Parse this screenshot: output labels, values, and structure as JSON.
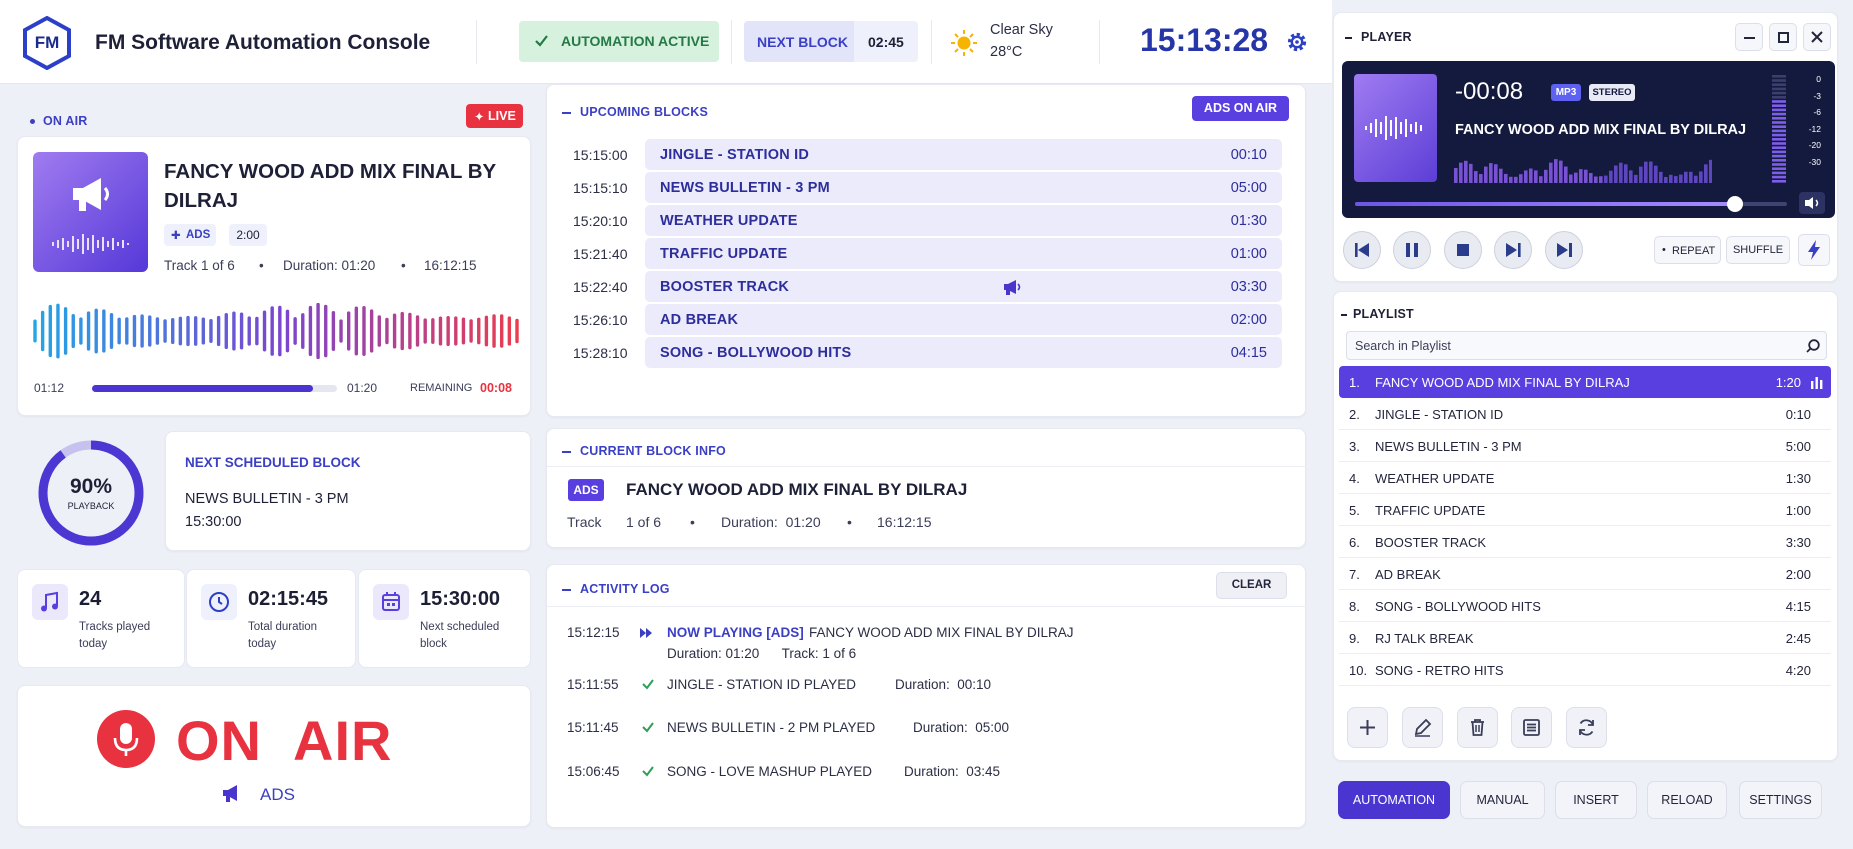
{
  "header": {
    "logo": "FM",
    "title": "FM Software Automation Console",
    "status": "AUTOMATION ACTIVE",
    "next_block_label": "NEXT BLOCK",
    "next_block_time": "02:45",
    "weather": "Clear Sky",
    "temperature": "28°C",
    "clock": "15:13:28"
  },
  "on_air": {
    "section": "ON AIR",
    "live_badge": "LIVE",
    "title_line1": "FANCY WOOD ADD MIX FINAL BY",
    "title_line2": "DILRAJ",
    "tag": "ADS",
    "tag_duration": "2:00",
    "track": "Track 1 of 6",
    "dot": "•",
    "duration": "Duration: 01:20",
    "start_time": "16:12:15",
    "elapsed": "01:12",
    "total": "01:20",
    "remaining_label": "REMAINING",
    "remaining": "00:08",
    "progress": 0.9
  },
  "next_scheduled": {
    "percent": "90%",
    "percent_value": 0.9,
    "percent_label": "PLAYBACK",
    "heading": "NEXT SCHEDULED BLOCK",
    "name": "NEWS BULLETIN - 3 PM",
    "time": "15:30:00"
  },
  "stats": [
    {
      "value": "24",
      "label1": "Tracks played",
      "label2": "today",
      "icon": "music-note-icon"
    },
    {
      "value": "02:15:45",
      "label1": "Total duration",
      "label2": "today",
      "icon": "clock-icon"
    },
    {
      "value": "15:30:00",
      "label1": "Next scheduled",
      "label2": "block",
      "icon": "calendar-icon"
    }
  ],
  "on_air_sign": {
    "text": "ON  AIR",
    "sub": "ADS"
  },
  "upcoming": {
    "section": "UPCOMING BLOCKS",
    "badge": "ADS ON AIR",
    "rows": [
      {
        "time": "15:15:00",
        "name": "JINGLE - STATION ID",
        "duration": "00:10"
      },
      {
        "time": "15:15:10",
        "name": "NEWS BULLETIN - 3 PM",
        "duration": "05:00"
      },
      {
        "time": "15:20:10",
        "name": "WEATHER UPDATE",
        "duration": "01:30"
      },
      {
        "time": "15:21:40",
        "name": "TRAFFIC UPDATE",
        "duration": "01:00"
      },
      {
        "time": "15:22:40",
        "name": "BOOSTER TRACK",
        "duration": "03:30"
      },
      {
        "time": "15:26:10",
        "name": "AD BREAK",
        "duration": "02:00"
      },
      {
        "time": "15:28:10",
        "name": "SONG - BOLLYWOOD HITS",
        "duration": "04:15"
      }
    ]
  },
  "current_block": {
    "section": "CURRENT BLOCK INFO",
    "tag": "ADS",
    "title": "FANCY WOOD ADD MIX FINAL BY DILRAJ",
    "track_label": "Track",
    "track": "1 of 6",
    "duration": "Duration:  01:20",
    "start": "16:12:15"
  },
  "activity": {
    "section": "ACTIVITY LOG",
    "clear": "CLEAR",
    "rows": [
      {
        "time": "15:12:15",
        "highlight": "NOW PLAYING [ADS]",
        "text": "FANCY WOOD ADD MIX FINAL BY DILRAJ",
        "sub": "Duration: 01:20      Track: 1 of 6"
      },
      {
        "time": "15:11:55",
        "text": "JINGLE - STATION ID PLAYED",
        "duration": "Duration:  00:10"
      },
      {
        "time": "15:11:45",
        "text": "NEWS BULLETIN - 2 PM PLAYED",
        "duration": "Duration:  05:00"
      },
      {
        "time": "15:06:45",
        "text": "SONG - LOVE MASHUP PLAYED",
        "duration": "Duration:  03:45"
      }
    ]
  },
  "player": {
    "section": "PLAYER",
    "countdown": "-00:08",
    "format": "MP3",
    "channels": "STEREO",
    "title": "FANCY WOOD ADD MIX FINAL BY DILRAJ",
    "scale": [
      "0",
      "-3",
      "-6",
      "-12",
      "-20",
      "-30"
    ],
    "seek": 0.88,
    "repeat": "REPEAT",
    "shuffle": "SHUFFLE"
  },
  "playlist": {
    "section": "PLAYLIST",
    "search_placeholder": "Search in Playlist",
    "items": [
      {
        "index": "1.",
        "name": "FANCY WOOD ADD MIX FINAL BY DILRAJ",
        "duration": "1:20"
      },
      {
        "index": "2.",
        "name": "JINGLE - STATION ID",
        "duration": "0:10"
      },
      {
        "index": "3.",
        "name": "NEWS BULLETIN - 3 PM",
        "duration": "5:00"
      },
      {
        "index": "4.",
        "name": "WEATHER UPDATE",
        "duration": "1:30"
      },
      {
        "index": "5.",
        "name": "TRAFFIC UPDATE",
        "duration": "1:00"
      },
      {
        "index": "6.",
        "name": "BOOSTER TRACK",
        "duration": "3:30"
      },
      {
        "index": "7.",
        "name": "AD BREAK",
        "duration": "2:00"
      },
      {
        "index": "8.",
        "name": "SONG - BOLLYWOOD HITS",
        "duration": "4:15"
      },
      {
        "index": "9.",
        "name": "RJ TALK BREAK",
        "duration": "2:45"
      },
      {
        "index": "10.",
        "name": "SONG - RETRO HITS",
        "duration": "4:20"
      }
    ]
  },
  "modes": [
    "AUTOMATION",
    "MANUAL",
    "INSERT",
    "RELOAD",
    "SETTINGS"
  ],
  "colors": {
    "accent": "#3b3fc4",
    "active": "#5a3fe0",
    "live": "#e8323f",
    "success": "#2e9e58"
  }
}
